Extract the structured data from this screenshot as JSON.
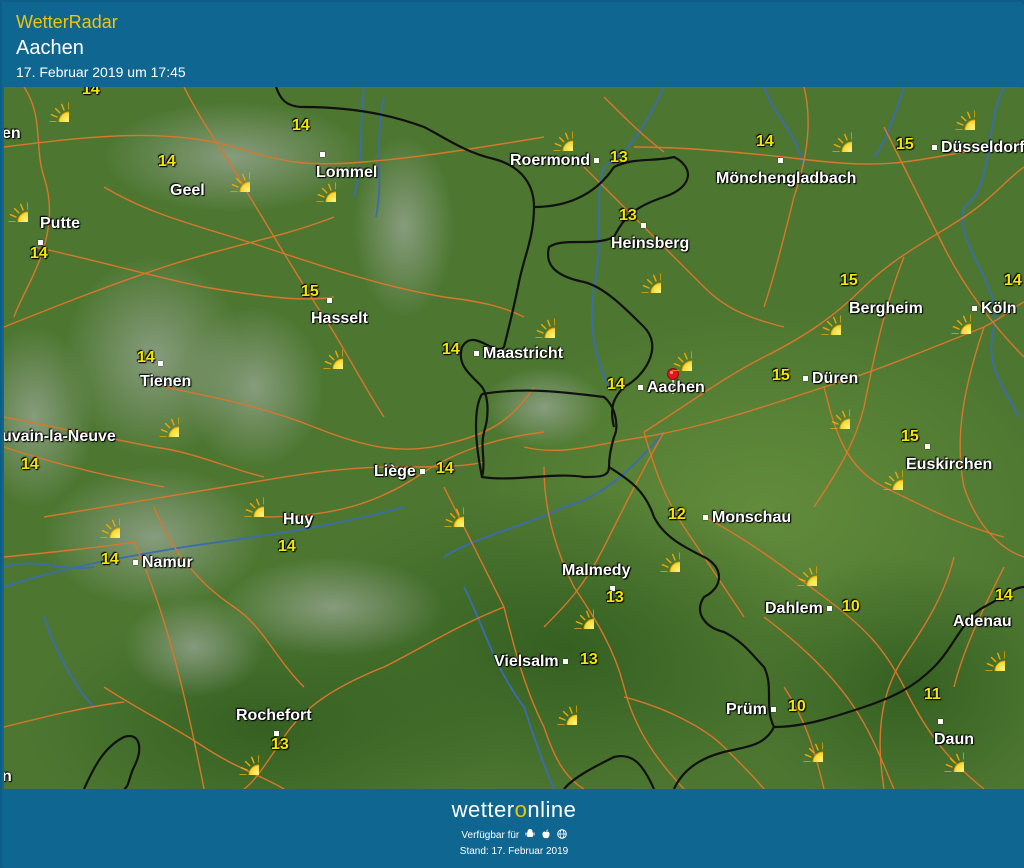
{
  "header": {
    "app_name": "WetterRadar",
    "location": "Aachen",
    "timestamp": "17. Februar 2019 um 17:45"
  },
  "map": {
    "cities": [
      {
        "id": "lommel",
        "name": "Lommel"
      },
      {
        "id": "roermond",
        "name": "Roermond"
      },
      {
        "id": "moenchengladbach",
        "name": "Mönchengladbach"
      },
      {
        "id": "duesseldorf",
        "name": "Düsseldorf"
      },
      {
        "id": "geel",
        "name": "Geel"
      },
      {
        "id": "putte",
        "name": "Putte"
      },
      {
        "id": "heinsberg",
        "name": "Heinsberg"
      },
      {
        "id": "hasselt",
        "name": "Hasselt"
      },
      {
        "id": "bergheim",
        "name": "Bergheim"
      },
      {
        "id": "koeln",
        "name": "Köln"
      },
      {
        "id": "maastricht",
        "name": "Maastricht"
      },
      {
        "id": "tienen",
        "name": "Tienen"
      },
      {
        "id": "aachen",
        "name": "Aachen"
      },
      {
        "id": "dueren",
        "name": "Düren"
      },
      {
        "id": "louvain",
        "name": "uvain-la-Neuve"
      },
      {
        "id": "euskirchen",
        "name": "Euskirchen"
      },
      {
        "id": "liege",
        "name": "Liège"
      },
      {
        "id": "huy",
        "name": "Huy"
      },
      {
        "id": "monschau",
        "name": "Monschau"
      },
      {
        "id": "namur",
        "name": "Namur"
      },
      {
        "id": "malmedy",
        "name": "Malmedy"
      },
      {
        "id": "dahlem",
        "name": "Dahlem"
      },
      {
        "id": "adenau",
        "name": "Adenau"
      },
      {
        "id": "vielsalm",
        "name": "Vielsalm"
      },
      {
        "id": "pruem",
        "name": "Prüm"
      },
      {
        "id": "daun",
        "name": "Daun"
      },
      {
        "id": "rochefort",
        "name": "Rochefort"
      },
      {
        "id": "en_edge",
        "name": "en"
      },
      {
        "id": "n_edge",
        "name": "n"
      }
    ],
    "temperatures": [
      {
        "id": "t1",
        "value": "14"
      },
      {
        "id": "t2",
        "value": "14"
      },
      {
        "id": "t3",
        "value": "13"
      },
      {
        "id": "t4",
        "value": "14"
      },
      {
        "id": "t5",
        "value": "15"
      },
      {
        "id": "t6",
        "value": "14"
      },
      {
        "id": "t7",
        "value": "14"
      },
      {
        "id": "t8",
        "value": "13"
      },
      {
        "id": "t9",
        "value": "15"
      },
      {
        "id": "t10",
        "value": "15"
      },
      {
        "id": "t11",
        "value": "14"
      },
      {
        "id": "t12",
        "value": "14"
      },
      {
        "id": "t13",
        "value": "14"
      },
      {
        "id": "t14",
        "value": "14"
      },
      {
        "id": "t15",
        "value": "15"
      },
      {
        "id": "t16",
        "value": "14"
      },
      {
        "id": "t17",
        "value": "15"
      },
      {
        "id": "t18",
        "value": "14"
      },
      {
        "id": "t19",
        "value": "12"
      },
      {
        "id": "t20",
        "value": "14"
      },
      {
        "id": "t21",
        "value": "14"
      },
      {
        "id": "t22",
        "value": "13"
      },
      {
        "id": "t23",
        "value": "10"
      },
      {
        "id": "t24",
        "value": "14"
      },
      {
        "id": "t25",
        "value": "13"
      },
      {
        "id": "t26",
        "value": "10"
      },
      {
        "id": "t27",
        "value": "11"
      },
      {
        "id": "t28",
        "value": "13"
      }
    ],
    "weather_icon": "sun-icon",
    "location_marker": "location-pin-icon",
    "colors": {
      "terrain": "#4f7a33",
      "roads": "#d9772a",
      "rivers": "#3a6db0",
      "borders": "#1a1a1a",
      "temperature": "#f4e600",
      "sun": "#f7d21a"
    }
  },
  "footer": {
    "logo_prefix": "wetter",
    "logo_o": "o",
    "logo_suffix": "nline",
    "available_label": "Verfügbar für",
    "platforms": [
      "android-icon",
      "apple-icon",
      "web-icon"
    ],
    "stand": "Stand: 17. Februar 2019"
  }
}
